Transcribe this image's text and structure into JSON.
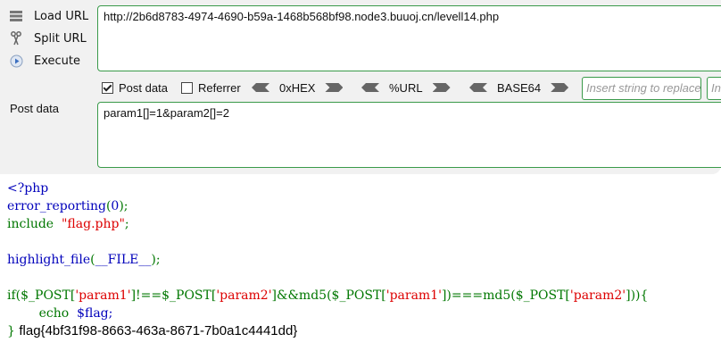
{
  "toolbar": {
    "load_url": "Load URL",
    "split_url": "Split URL",
    "execute": "Execute",
    "post_data_label": "Post data"
  },
  "url": "http://2b6d8783-4974-4690-b59a-1468b568bf98.node3.buuoj.cn/levell14.php",
  "options": {
    "post_data": "Post data",
    "post_data_checked": true,
    "referrer": "Referrer",
    "referrer_checked": false
  },
  "encoders": [
    "0xHEX",
    "%URL",
    "BASE64"
  ],
  "replace": {
    "placeholder1": "Insert string to replace",
    "placeholder2": "Insert replacing string"
  },
  "post_body": "param1[]=1&param2[]=2",
  "source": {
    "open_tag": "<?php",
    "err_fn": "error_reporting",
    "err_arg": "0",
    "include_kw": "include",
    "include_str": "\"flag.php\"",
    "hl_fn": "highlight_file",
    "hl_arg": "__FILE__",
    "if_a": "if($_POST[",
    "p1": "'param1'",
    "if_b": "]!==$_POST[",
    "p2": "'param2'",
    "if_c": "]&&md5($_POST[",
    "if_d": "])===md5($_POST[",
    "if_e": "])){",
    "echo_kw": "echo",
    "echo_var": "$flag;",
    "close_brace": "}"
  },
  "flag_output": "flag{4bf31f98-8663-463a-8671-7b0a1c4441dd}",
  "colors": {
    "keyword": "#0000bb",
    "string": "#dd0000",
    "operator": "#007700",
    "border": "#3a9a4a"
  }
}
